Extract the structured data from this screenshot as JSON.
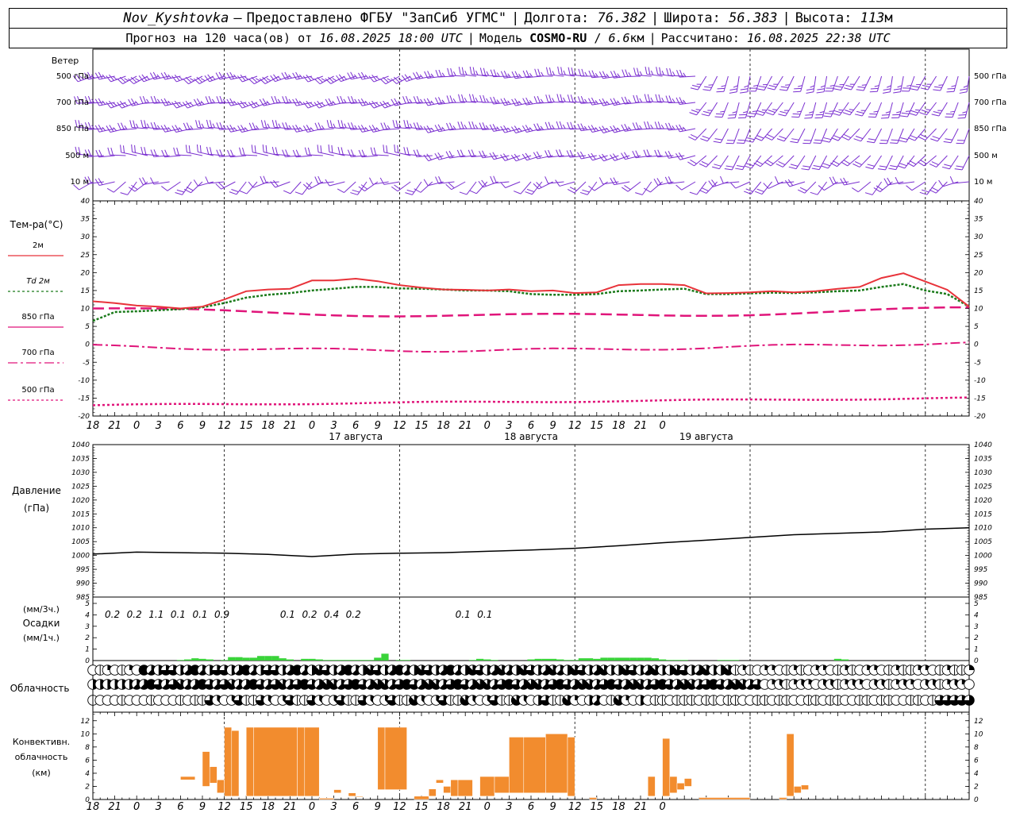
{
  "header": {
    "station": "Nov_Kyshtovka",
    "dash": "—",
    "provider": "Предоставлено ФГБУ \"ЗапСиб УГМС\"",
    "lon_label": "Долгота:",
    "lon": "76.382",
    "lat_label": "Широта:",
    "lat": "56.383",
    "alt_label": "Высота:",
    "alt": "113",
    "alt_unit": "м",
    "forecast_label": "Прогноз на 120 часа(ов) от",
    "forecast_from": "16.08.2025 18:00 UTC",
    "model_label": "Модель",
    "model": "COSMO-RU",
    "model_sep": "/",
    "model_res": "6.6",
    "model_res_unit": "км",
    "computed_label": "Рассчитано:",
    "computed": "16.08.2025 22:38 UTC",
    "bar": "|"
  },
  "colors": {
    "wind": "#7a2fd0",
    "t2m": "#e8333a",
    "td": "#1a7a1a",
    "isobaric": "#e0157a",
    "pressure": "#000000",
    "precip": "#3ad33a",
    "convective": "#f28c2e"
  },
  "wind_panel": {
    "title": "Ветер",
    "levels": [
      "500 гПа",
      "700 гПа",
      "850 гПа",
      "500 м",
      "10  м"
    ]
  },
  "temp_panel": {
    "title": "Тем-ра(°С)",
    "legend": [
      {
        "label": "2м",
        "style": "solid",
        "color": "#e8333a"
      },
      {
        "label": "Td  2м",
        "style": "dotted",
        "color": "#1a7a1a"
      },
      {
        "label": "850 гПа",
        "style": "solid",
        "color": "#e0157a"
      },
      {
        "label": "700 гПа",
        "style": "dashdot",
        "color": "#e0157a"
      },
      {
        "label": "500 гПа",
        "style": "dotted",
        "color": "#e0157a"
      }
    ],
    "yticks": [
      "40",
      "35",
      "30",
      "25",
      "20",
      "15",
      "10",
      "5",
      "0",
      "-5",
      "-10",
      "-15",
      "-20"
    ]
  },
  "time_axis": {
    "hour_labels": [
      "18",
      "21",
      "0",
      "3",
      "6",
      "9",
      "12",
      "15",
      "18",
      "21",
      "0",
      "3",
      "6",
      "9",
      "12",
      "15",
      "18",
      "21",
      "0",
      "3",
      "6",
      "9",
      "12",
      "15",
      "18",
      "21",
      "0"
    ],
    "dates": [
      "17 августа",
      "18 августа",
      "19 августа"
    ]
  },
  "pressure_panel": {
    "title": "Давление",
    "unit": "(гПа)",
    "yticks": [
      "1040",
      "1035",
      "1030",
      "1025",
      "1020",
      "1015",
      "1010",
      "1005",
      "1000",
      "995",
      "990",
      "985"
    ]
  },
  "precip_panel": {
    "label1": "(мм/3ч.)",
    "label2": "Осадки",
    "label3": "(мм/1ч.)",
    "yticks": [
      "5",
      "4",
      "3",
      "2",
      "1",
      "0"
    ],
    "totals": [
      {
        "hour": 3,
        "value": "0.2"
      },
      {
        "hour": 6,
        "value": "0.2"
      },
      {
        "hour": 9,
        "value": "1.1"
      },
      {
        "hour": 12,
        "value": "0.1"
      },
      {
        "hour": 15,
        "value": "0.1"
      },
      {
        "hour": 18,
        "value": "0.9"
      },
      {
        "hour": 27,
        "value": "0.1"
      },
      {
        "hour": 30,
        "value": "0.2"
      },
      {
        "hour": 33,
        "value": "0.4"
      },
      {
        "hour": 36,
        "value": "0.2"
      },
      {
        "hour": 51,
        "value": "0.1"
      },
      {
        "hour": 54,
        "value": "0.1"
      }
    ]
  },
  "cloud_panel": {
    "title": "Облачность"
  },
  "conv_panel": {
    "label1": "Конвективн.",
    "label2": "облачность",
    "label3": "(км)",
    "yticks": [
      "12",
      "10",
      "8",
      "6",
      "4",
      "2",
      "0"
    ]
  },
  "chart_data": [
    {
      "type": "line",
      "title": "Тем-ра(°С)",
      "xlabel": "",
      "ylabel": "Тем-ра(°С)",
      "ylim": [
        -20,
        40
      ],
      "x_hours_from_start": [
        0,
        3,
        6,
        9,
        12,
        15,
        18,
        21,
        24,
        27,
        30,
        33,
        36,
        39,
        42,
        45,
        48,
        51,
        54,
        57,
        60,
        63,
        66,
        69,
        72,
        75,
        78,
        81,
        84,
        87,
        90,
        93,
        96,
        99,
        102,
        105,
        108,
        111,
        114,
        117,
        120
      ],
      "series": [
        {
          "name": "2м",
          "values": [
            12,
            11.5,
            10.8,
            10.5,
            10,
            10.5,
            12.5,
            14.8,
            15.3,
            15.5,
            17.8,
            17.8,
            18.3,
            17.6,
            16.5,
            15.8,
            15.3,
            15.2,
            15,
            15.3,
            14.8,
            15,
            14.3,
            14.5,
            16.5,
            16.8,
            16.8,
            16.5,
            14.2,
            14.3,
            14.5,
            14.8,
            14.5,
            14.8,
            15.5,
            16,
            18.5,
            19.8,
            17.5,
            15.2,
            10.5
          ]
        },
        {
          "name": "Td  2м",
          "values": [
            6.5,
            9,
            9.2,
            9.5,
            9.8,
            10.3,
            11.5,
            13,
            13.8,
            14.3,
            15,
            15.5,
            16,
            16,
            15.6,
            15.5,
            15.3,
            15,
            15,
            14.8,
            14,
            13.8,
            13.8,
            14,
            14.8,
            15,
            15.3,
            15.5,
            14,
            14,
            14.2,
            14.4,
            14.3,
            14.5,
            14.8,
            15,
            16,
            16.8,
            15,
            14,
            10.5
          ]
        }
      ]
    },
    {
      "type": "line",
      "title": "Давление",
      "ylabel": "(гПа)",
      "ylim": [
        985,
        1040
      ],
      "x_hours_from_start": [
        0,
        6,
        12,
        18,
        24,
        30,
        36,
        42,
        48,
        54,
        60,
        66,
        72,
        78,
        84,
        90,
        96,
        102,
        108,
        114,
        120
      ],
      "values": [
        1000.5,
        1001.2,
        1001,
        1000.8,
        1000.4,
        999.6,
        1000.5,
        1000.8,
        1001,
        1001.5,
        1002,
        1002.6,
        1003.5,
        1004.6,
        1005.5,
        1006.5,
        1007.5,
        1008,
        1008.5,
        1009.5,
        1010
      ]
    },
    {
      "type": "bar",
      "title": "Осадки",
      "ylabel": "(мм/1ч.)",
      "ylim": [
        0,
        5
      ],
      "x_hours_from_start": [
        12,
        13,
        14,
        15,
        16,
        18,
        19,
        20,
        21,
        22,
        23,
        24,
        25,
        26,
        27,
        29,
        30,
        31,
        32,
        33,
        34,
        35,
        36,
        37,
        38,
        39,
        40,
        42,
        43,
        52,
        53,
        54,
        55,
        60,
        61,
        62,
        63,
        64,
        65,
        66,
        67,
        68,
        69,
        70,
        71,
        72,
        73,
        74,
        75,
        76,
        77,
        78,
        79,
        80,
        81,
        86,
        87,
        88,
        102,
        103
      ],
      "values": [
        0.05,
        0.1,
        0.2,
        0.15,
        0.1,
        0.05,
        0.3,
        0.3,
        0.25,
        0.25,
        0.4,
        0.4,
        0.4,
        0.2,
        0.1,
        0.15,
        0.15,
        0.1,
        0.05,
        0.05,
        0.05,
        0.05,
        0.05,
        0.05,
        0.05,
        0.25,
        0.6,
        0.05,
        0.05,
        0.05,
        0.15,
        0.1,
        0.05,
        0.1,
        0.15,
        0.15,
        0.15,
        0.1,
        0.05,
        0.05,
        0.2,
        0.2,
        0.15,
        0.25,
        0.25,
        0.25,
        0.25,
        0.25,
        0.25,
        0.25,
        0.2,
        0.1,
        0.05,
        0.05,
        0.05,
        0.05,
        0.05,
        0.05,
        0.15,
        0.1
      ]
    }
  ]
}
